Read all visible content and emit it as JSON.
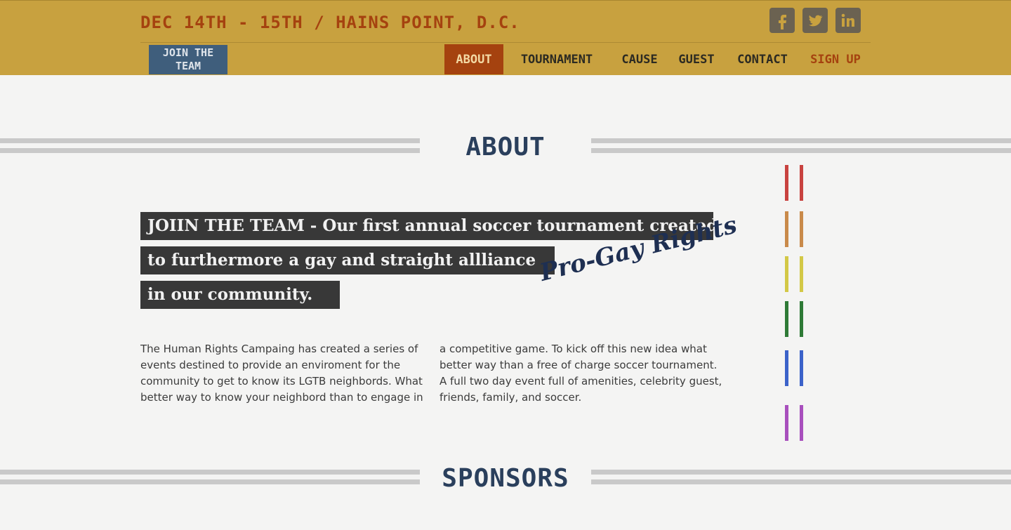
{
  "header": {
    "event_date": "DEC 14TH - 15TH / HAINS POINT, D.C.",
    "join_badge": "JOIN THE TEAM",
    "social": [
      "facebook-icon",
      "twitter-icon",
      "linkedin-icon"
    ]
  },
  "nav": {
    "items": [
      "ABOUT",
      "TOURNAMENT",
      "CAUSE",
      "GUEST",
      "CONTACT",
      "SIGN UP"
    ],
    "active": "ABOUT"
  },
  "about": {
    "title": "ABOUT",
    "headline_lines": [
      "JOIIN THE TEAM - Our first annual soccer tournament created",
      "to furthermore a gay and straight allliance",
      "in our community."
    ],
    "script_tag": "Pro-Gay Rights",
    "col1": "The Human Rights Campaing has created a series of events destined to provide an enviroment for the community to get to know its LGTB neighbords. What better way to know your neighbord than to engage in",
    "col2": "a competitive game. To kick off this new idea what better way than a free of charge soccer tournament. A full two day event full of amenities, celebrity guest, friends, family, and soccer."
  },
  "sponsors": {
    "title": "SPONSORS"
  },
  "colors": {
    "header_bg": "#c8a13f",
    "accent": "#a5420f",
    "title_navy": "#2a3f5c",
    "rainbow": [
      "#c8423f",
      "#c98a4a",
      "#d3c846",
      "#2e7a36",
      "#3b62c9",
      "#a84fbd"
    ]
  }
}
